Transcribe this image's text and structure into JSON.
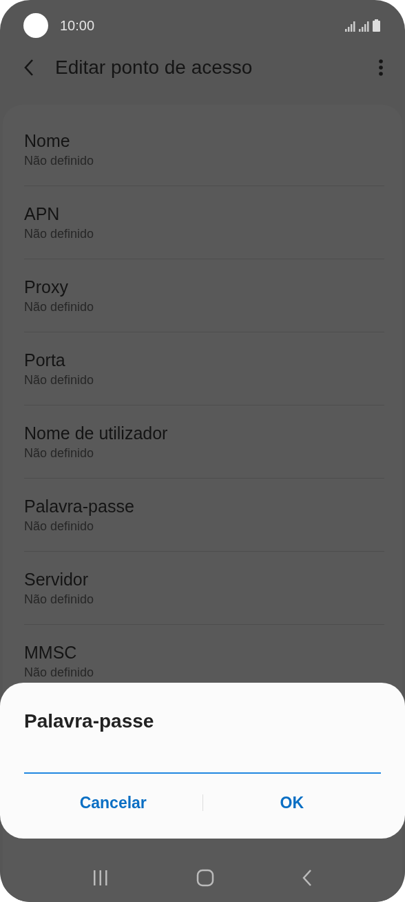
{
  "status_bar": {
    "time": "10:00"
  },
  "app_bar": {
    "title": "Editar ponto de acesso"
  },
  "settings": [
    {
      "label": "Nome",
      "value": "Não definido"
    },
    {
      "label": "APN",
      "value": "Não definido"
    },
    {
      "label": "Proxy",
      "value": "Não definido"
    },
    {
      "label": "Porta",
      "value": "Não definido"
    },
    {
      "label": "Nome de utilizador",
      "value": "Não definido"
    },
    {
      "label": "Palavra-passe",
      "value": "Não definido"
    },
    {
      "label": "Servidor",
      "value": "Não definido"
    },
    {
      "label": "MMSC",
      "value": "Não definido"
    }
  ],
  "dialog": {
    "title": "Palavra-passe",
    "buttons": [
      "Cancelar",
      "OK"
    ]
  }
}
